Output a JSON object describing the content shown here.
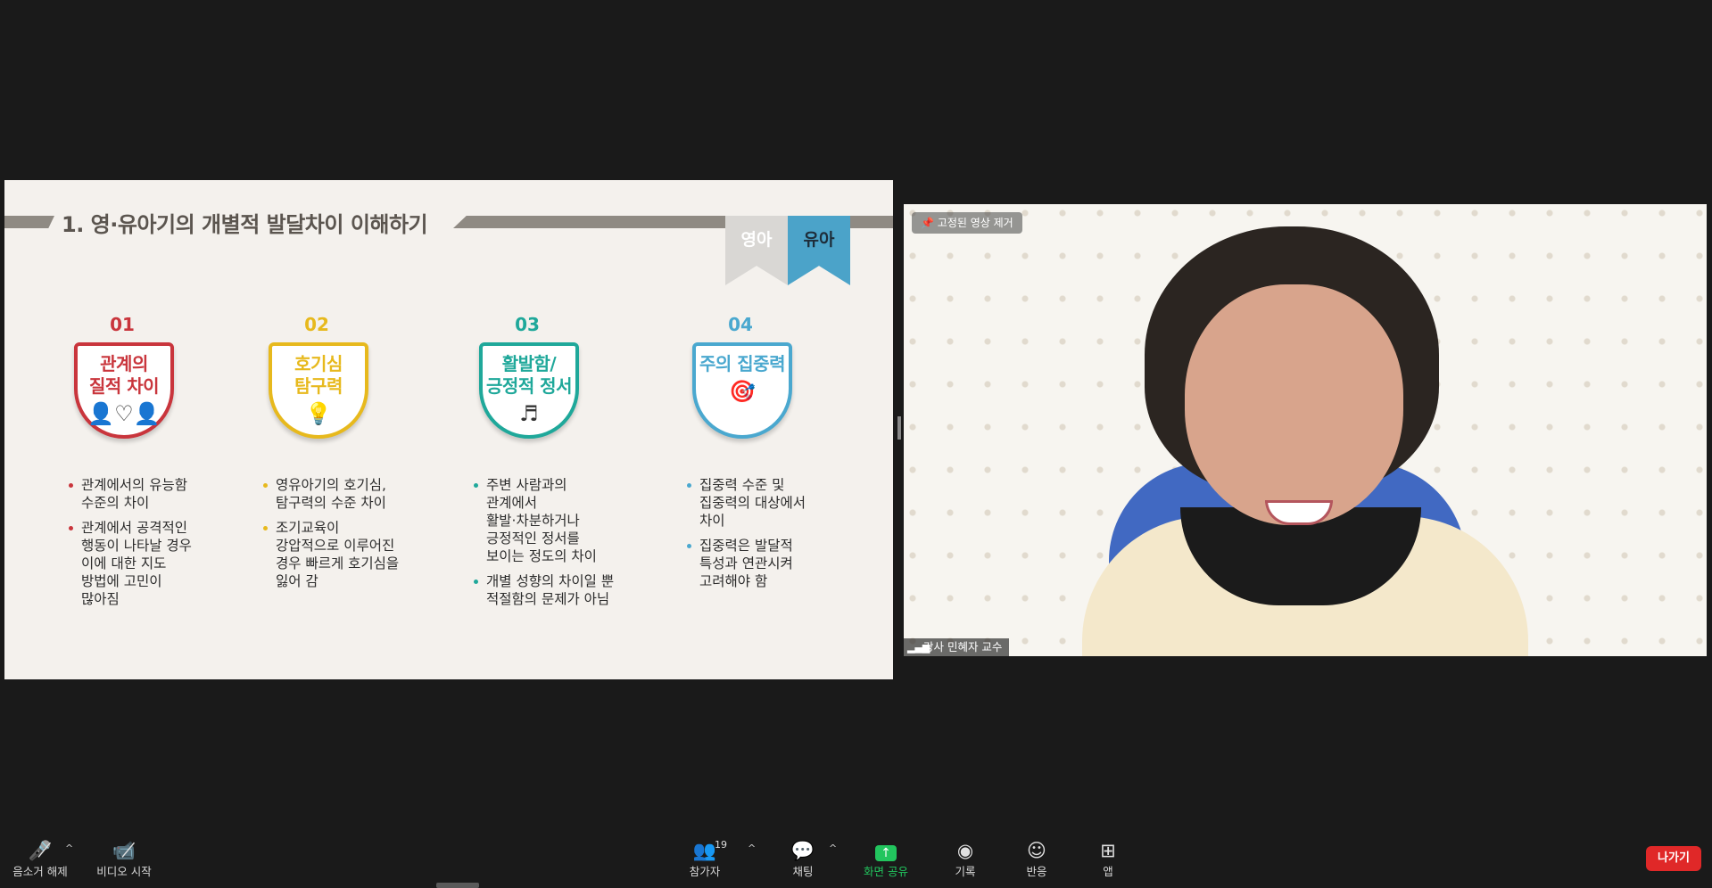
{
  "slide": {
    "title": "1. 영·유아기의 개별적 발달차이 이해하기",
    "tab_infant": "영아",
    "tab_child": "유아",
    "columns": [
      {
        "number": "01",
        "title_line1": "관계의",
        "title_line2": "질적 차이",
        "icon": "people-heart-icon",
        "color": "#c9353c",
        "bullets": [
          "관계에서의 유능함\n수준의 차이",
          "관계에서 공격적인\n행동이 나타날 경우\n이에 대한 지도\n방법에 고민이\n많아짐"
        ]
      },
      {
        "number": "02",
        "title_line1": "호기심",
        "title_line2": "탐구력",
        "icon": "lightbulb-icon",
        "color": "#e7b91d",
        "bullets": [
          "영유아기의 호기심,\n탐구력의 수준 차이",
          "조기교육이\n강압적으로 이루어진\n경우 빠르게 호기심을\n잃어 감"
        ]
      },
      {
        "number": "03",
        "title_line1": "활발함/",
        "title_line2": "긍정적 정서",
        "icon": "music-note-icon",
        "color": "#1fa89a",
        "bullets": [
          "주변 사람과의\n관계에서\n활발·차분하거나\n긍정적인 정서를\n보이는 정도의 차이",
          "개별 성향의 차이일 뿐\n적절함의 문제가 아님"
        ]
      },
      {
        "number": "04",
        "title_line1": "주의 집중력",
        "title_line2": "",
        "icon": "target-icon",
        "color": "#4aa8cf",
        "bullets": [
          "집중력 수준 및\n집중력의 대상에서\n차이",
          "집중력은 발달적\n특성과 연관시켜\n고려해야 함"
        ]
      }
    ]
  },
  "video": {
    "pin_label": "고정된 영상 제거",
    "participant_name": "강사 민혜자 교수"
  },
  "toolbar": {
    "mute_label": "음소거 해제",
    "video_label": "비디오 시작",
    "participants_label": "참가자",
    "participants_count": "19",
    "chat_label": "채팅",
    "share_label": "화면 공유",
    "record_label": "기록",
    "reactions_label": "반응",
    "apps_label": "앱",
    "leave_label": "나가기"
  }
}
